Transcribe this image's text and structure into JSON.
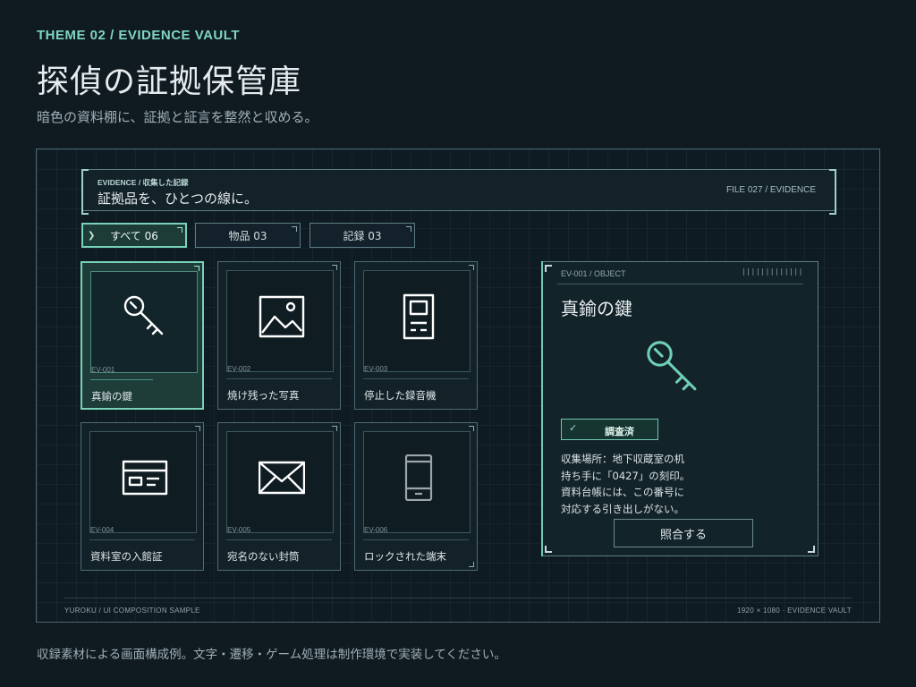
{
  "header": {
    "theme_label": "THEME 02 / EVIDENCE VAULT",
    "title": "探偵の証拠保管庫",
    "subtitle": "暗色の資料棚に、証拠と証言を整然と収める。"
  },
  "panel": {
    "kicker": "EVIDENCE / 収集した記録",
    "title": "証拠品を、ひとつの線に。",
    "file_label": "FILE 027 / EVIDENCE",
    "footer_left": "YUROKU / UI COMPOSITION SAMPLE",
    "footer_right": "1920 × 1080 · EVIDENCE VAULT"
  },
  "tabs": [
    {
      "label": "すべて 06",
      "active": true
    },
    {
      "label": "物品 03",
      "active": false
    },
    {
      "label": "記録 03",
      "active": false
    }
  ],
  "cards": [
    {
      "code": "EV-001",
      "name": "真鍮の鍵",
      "icon": "key-icon",
      "selected": true
    },
    {
      "code": "EV-002",
      "name": "焼け残った写真",
      "icon": "image-icon",
      "selected": false
    },
    {
      "code": "EV-003",
      "name": "停止した録音機",
      "icon": "recorder-icon",
      "selected": false
    },
    {
      "code": "EV-004",
      "name": "資料室の入館証",
      "icon": "id-card-icon",
      "selected": false
    },
    {
      "code": "EV-005",
      "name": "宛名のない封筒",
      "icon": "envelope-icon",
      "selected": false
    },
    {
      "code": "EV-006",
      "name": "ロックされた端末",
      "icon": "phone-icon",
      "selected": false
    }
  ],
  "detail": {
    "code": "EV-001 / OBJECT",
    "ticks": "|||||||||||||",
    "title": "真鍮の鍵",
    "icon": "key-icon",
    "status": "調査済",
    "description": [
      "収集場所：地下収蔵室の机",
      "持ち手に「0427」の刻印。",
      "資料台帳には、この番号に",
      "対応する引き出しがない。"
    ],
    "action_label": "照合する"
  },
  "footer_note": "収録素材による画面構成例。文字・遷移・ゲーム処理は制作環境で実装してください。",
  "colors": {
    "background": "#0f1a21",
    "accent": "#78d2b9",
    "theme_label": "#7fd6c0"
  }
}
